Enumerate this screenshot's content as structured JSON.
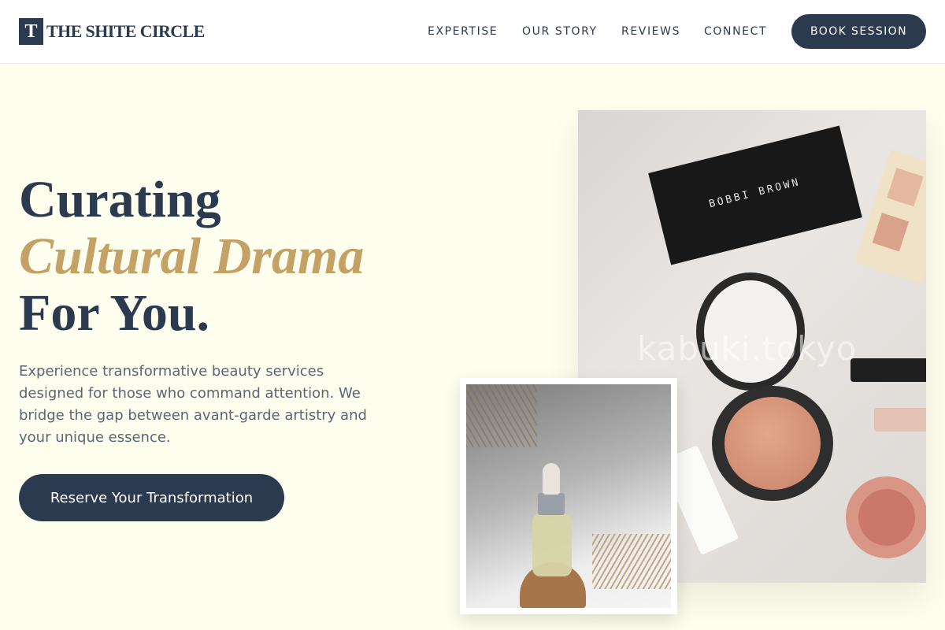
{
  "brand": {
    "mark": "T",
    "name": "THE SHITE CIRCLE"
  },
  "nav": {
    "items": [
      "EXPERTISE",
      "OUR STORY",
      "REVIEWS",
      "CONNECT"
    ],
    "cta": "BOOK SESSION"
  },
  "hero": {
    "line1": "Curating",
    "line2": "Cultural Drama",
    "line3": "For You.",
    "description": "Experience transformative beauty services designed for those who command attention. We bridge the gap between avant-garde artistry and your unique essence.",
    "cta": "Reserve Your Transformation"
  },
  "images": {
    "main_photo": {
      "palette_brand": "BOBBI BROWN",
      "watermark": "kabuki.tokyo"
    }
  },
  "colors": {
    "background": "#fefeee",
    "primary": "#2c3a4f",
    "accent": "#c4a265",
    "muted_text": "#5b6576"
  }
}
